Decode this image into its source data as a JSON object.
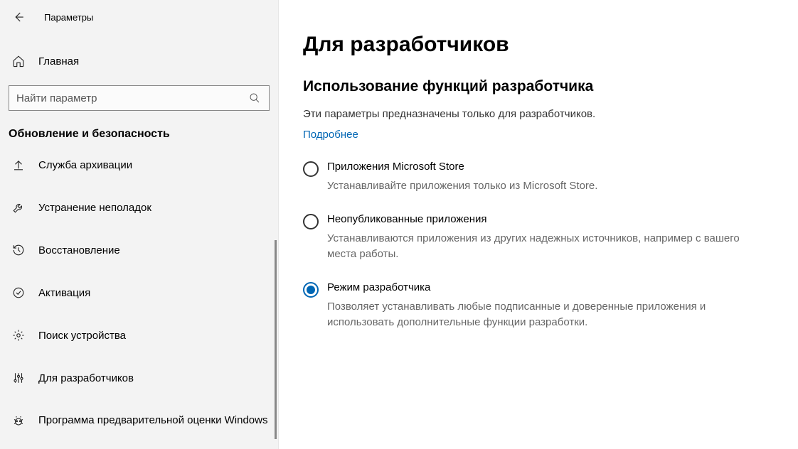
{
  "window": {
    "title": "Параметры"
  },
  "sidebar": {
    "home": "Главная",
    "search_placeholder": "Найти параметр",
    "section": "Обновление и безопасность",
    "items": [
      {
        "label": "Служба архивации"
      },
      {
        "label": "Устранение неполадок"
      },
      {
        "label": "Восстановление"
      },
      {
        "label": "Активация"
      },
      {
        "label": "Поиск устройства"
      },
      {
        "label": "Для разработчиков"
      },
      {
        "label": "Программа предварительной оценки Windows"
      }
    ]
  },
  "main": {
    "title": "Для разработчиков",
    "subtitle": "Использование функций разработчика",
    "desc": "Эти параметры предназначены только для разработчиков.",
    "more_link": "Подробнее",
    "options": [
      {
        "title": "Приложения Microsoft Store",
        "desc": "Устанавливайте приложения только из Microsoft Store.",
        "selected": false
      },
      {
        "title": "Неопубликованные приложения",
        "desc": "Устанавливаются приложения из других надежных источников, например с вашего места работы.",
        "selected": false
      },
      {
        "title": "Режим разработчика",
        "desc": "Позволяет устанавливать любые подписанные и доверенные приложения и использовать дополнительные функции разработки.",
        "selected": true
      }
    ]
  }
}
